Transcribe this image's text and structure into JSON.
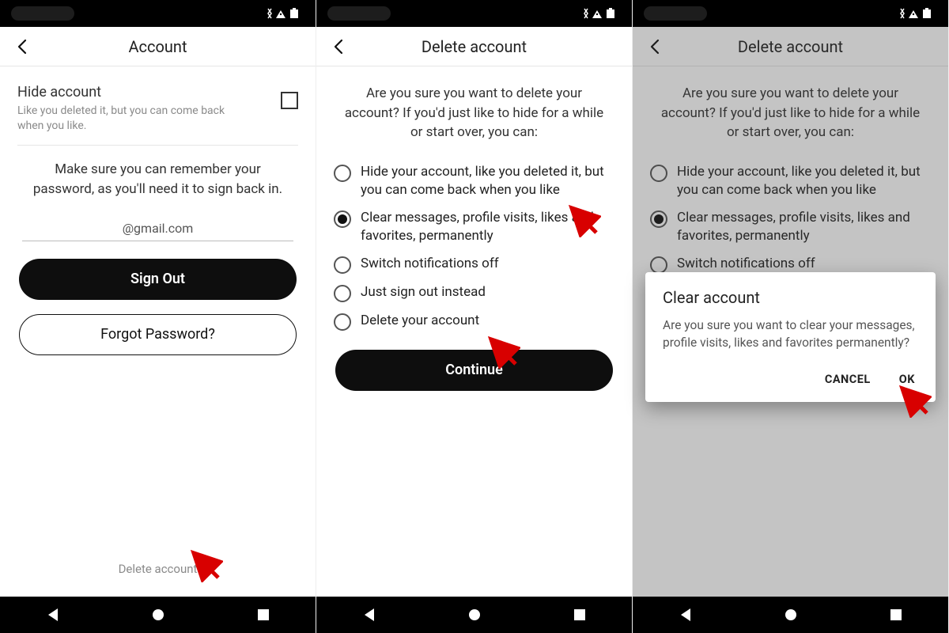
{
  "status": {
    "icons": "↕ ▾ ■"
  },
  "screen1": {
    "title": "Account",
    "hide_title": "Hide account",
    "hide_sub": "Like you deleted it, but you can come back when you like.",
    "remember": "Make sure you can remember your password, as you'll need it to sign back in.",
    "email": "@gmail.com",
    "sign_out": "Sign Out",
    "forgot": "Forgot Password?",
    "delete_link": "Delete account"
  },
  "screen2": {
    "title": "Delete account",
    "prompt": "Are you sure you want to delete your account? If you'd just like to hide for a while or start over, you can:",
    "options": [
      "Hide your account, like you deleted it, but you can come back when you like",
      "Clear messages, profile visits, likes and favorites, permanently",
      "Switch notifications off",
      "Just sign out instead",
      "Delete your account"
    ],
    "continue": "Continue"
  },
  "screen3": {
    "dialog_title": "Clear account",
    "dialog_body": "Are you sure you want to clear your messages, profile visits, likes and favorites permanently?",
    "cancel": "CANCEL",
    "ok": "OK"
  }
}
